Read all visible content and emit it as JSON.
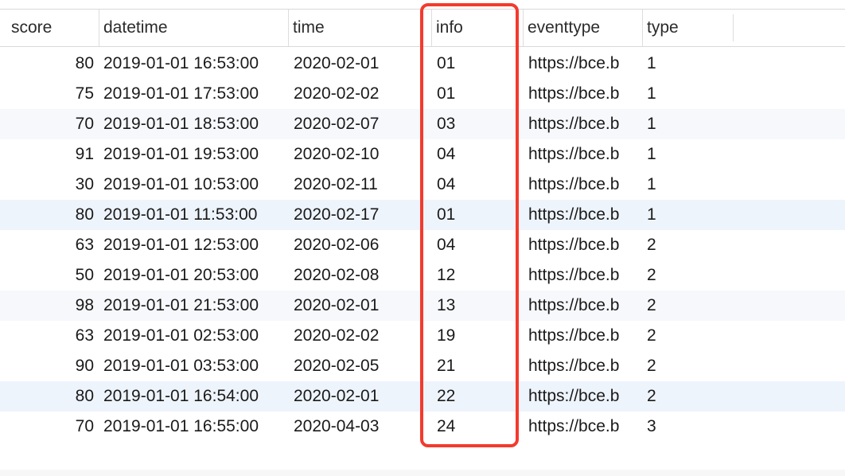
{
  "columns": [
    {
      "key": "score",
      "label": "score"
    },
    {
      "key": "datetime",
      "label": "datetime"
    },
    {
      "key": "time",
      "label": "time"
    },
    {
      "key": "info",
      "label": "info"
    },
    {
      "key": "eventtype",
      "label": "eventtype"
    },
    {
      "key": "type",
      "label": "type"
    }
  ],
  "rows": [
    {
      "score": "80",
      "datetime": "2019-01-01 16:53:00",
      "time": "2020-02-01",
      "info": "01",
      "eventtype": "https://bce.b",
      "type": "1"
    },
    {
      "score": "75",
      "datetime": "2019-01-01 17:53:00",
      "time": "2020-02-02",
      "info": "01",
      "eventtype": "https://bce.b",
      "type": "1"
    },
    {
      "score": "70",
      "datetime": "2019-01-01 18:53:00",
      "time": "2020-02-07",
      "info": "03",
      "eventtype": "https://bce.b",
      "type": "1"
    },
    {
      "score": "91",
      "datetime": "2019-01-01 19:53:00",
      "time": "2020-02-10",
      "info": "04",
      "eventtype": "https://bce.b",
      "type": "1"
    },
    {
      "score": "30",
      "datetime": "2019-01-01 10:53:00",
      "time": "2020-02-11",
      "info": "04",
      "eventtype": "https://bce.b",
      "type": "1"
    },
    {
      "score": "80",
      "datetime": "2019-01-01 11:53:00",
      "time": "2020-02-17",
      "info": "01",
      "eventtype": "https://bce.b",
      "type": "1"
    },
    {
      "score": "63",
      "datetime": "2019-01-01 12:53:00",
      "time": "2020-02-06",
      "info": "04",
      "eventtype": "https://bce.b",
      "type": "2"
    },
    {
      "score": "50",
      "datetime": "2019-01-01 20:53:00",
      "time": "2020-02-08",
      "info": "12",
      "eventtype": "https://bce.b",
      "type": "2"
    },
    {
      "score": "98",
      "datetime": "2019-01-01 21:53:00",
      "time": "2020-02-01",
      "info": "13",
      "eventtype": "https://bce.b",
      "type": "2"
    },
    {
      "score": "63",
      "datetime": "2019-01-01 02:53:00",
      "time": "2020-02-02",
      "info": "19",
      "eventtype": "https://bce.b",
      "type": "2"
    },
    {
      "score": "90",
      "datetime": "2019-01-01 03:53:00",
      "time": "2020-02-05",
      "info": "21",
      "eventtype": "https://bce.b",
      "type": "2"
    },
    {
      "score": "80",
      "datetime": "2019-01-01 16:54:00",
      "time": "2020-02-01",
      "info": "22",
      "eventtype": "https://bce.b",
      "type": "2"
    },
    {
      "score": "70",
      "datetime": "2019-01-01 16:55:00",
      "time": "2020-04-03",
      "info": "24",
      "eventtype": "https://bce.b",
      "type": "3"
    }
  ],
  "highlighted_column": "info",
  "colors": {
    "highlight": "#f23b2e",
    "alt_row": "#f6f8fb",
    "selected_row": "#eef4fc"
  }
}
